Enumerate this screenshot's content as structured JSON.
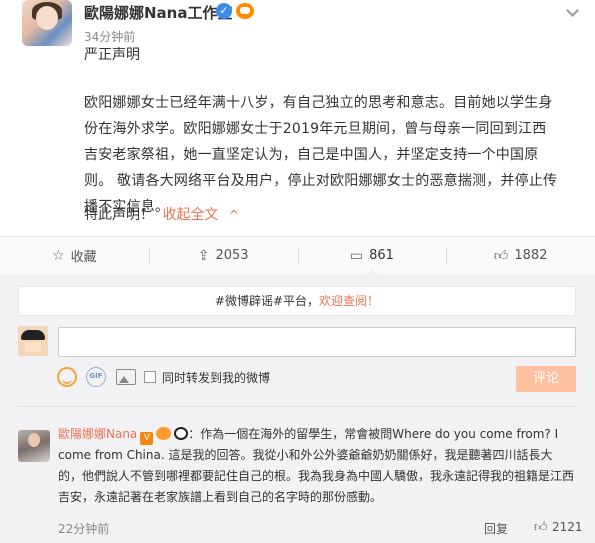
{
  "post": {
    "author": "歐陽娜娜Nana工作室",
    "verified_icon": "verified-icon",
    "vip_icon": "vip-crown-icon",
    "time": "34分钟前",
    "title": "严正声明",
    "body": "欧阳娜娜女士已经年满十八岁，有自己独立的思考和意志。目前她以学生身份在海外求学。欧阳娜娜女士于2019年元旦期间，曾与母亲一同回到江西吉安老家祭祖，她一直坚定认为，自己是中国人，并坚定支持一个中国原则。 敬请各大网络平台及用户，停止对欧阳娜娜女士的恶意揣测，并停止传播不实信息。",
    "end": "特此声明！",
    "collapse_label": "收起全文",
    "collapse_arrow": "^"
  },
  "actions": {
    "favorite": {
      "icon": "star-icon",
      "label": "收藏"
    },
    "repost": {
      "icon": "repost-icon",
      "label": "2053"
    },
    "comment": {
      "icon": "comment-icon",
      "label": "861"
    },
    "like": {
      "icon": "thumb-up-icon",
      "label": "1882"
    }
  },
  "comment_panel": {
    "notice_prefix": "#微博辟谣#平台，",
    "notice_highlight": "欢迎查阅！",
    "input_placeholder": "",
    "gif_label": "GIF",
    "repost_checkbox_label": "同时转发到我的微博",
    "submit_label": "评论"
  },
  "comments": [
    {
      "name": "歐陽娜娜Nana",
      "badge": "V",
      "text": "：作為一個在海外的留學生，常會被問Where do you come from? I come from China. 這是我的回答。我從小和外公外婆爺爺奶奶關係好，我是聽著四川話長大的，他們說人不管到哪裡都要記住自己的根。我為我身為中國人驕傲，我永遠記得我的祖籍是江西吉安，永遠記著在老家族譜上看到自己的名字時的那份感動。",
      "time": "22分钟前",
      "reply_label": "回复",
      "like_count": "2121"
    }
  ],
  "colors": {
    "accent": "#eb7350",
    "submit_disabled": "#ffc09f",
    "panel_bg": "#f2f2f5",
    "verified": "#3a8ce8"
  }
}
